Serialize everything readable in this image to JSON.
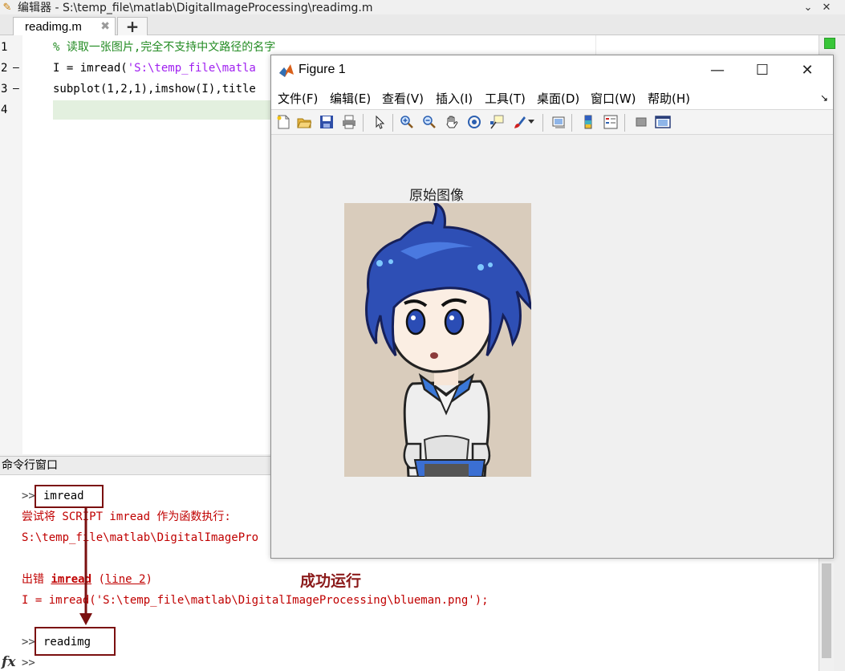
{
  "editor": {
    "title": "编辑器 - S:\\temp_file\\matlab\\DigitalImageProcessing\\readimg.m",
    "tab_label": "readimg.m",
    "tab_close": "✖",
    "add_tab": "+",
    "line_numbers": [
      "1",
      "2",
      "3",
      "4"
    ],
    "breakpoint_dashes": [
      "—",
      "—"
    ],
    "code": {
      "line1": "% 读取一张图片,完全不支持中文路径的名字",
      "line2_prefix": "I = imread(",
      "line2_string": "'S:\\temp_file\\matla",
      "line3": "subplot(1,2,1),imshow(I),title"
    }
  },
  "command_window": {
    "title": "命令行窗口",
    "prompt": ">>",
    "cmd1": "imread",
    "err1": "尝试将 SCRIPT imread 作为函数执行:",
    "err2": "S:\\temp_file\\matlab\\DigitalImagePro",
    "err3_prefix": "出错 ",
    "err3_link": "imread",
    "err3_paren_open": " (",
    "err3_line": "line 2",
    "err3_paren_close": ")",
    "err4": "I = imread('S:\\temp_file\\matlab\\DigitalImageProcessing\\blueman.png');",
    "cmd2": "readimg",
    "fx_label": "fx",
    "annotation": "成功运行"
  },
  "figure": {
    "title": "Figure 1",
    "menus": [
      "文件(F)",
      "编辑(E)",
      "查看(V)",
      "插入(I)",
      "工具(T)",
      "桌面(D)",
      "窗口(W)",
      "帮助(H)"
    ],
    "axes_title": "原始图像"
  },
  "colors": {
    "annotation": "#8b1a1a",
    "error_text": "#c00000",
    "comment": "#228b22",
    "string": "#a020f0"
  }
}
